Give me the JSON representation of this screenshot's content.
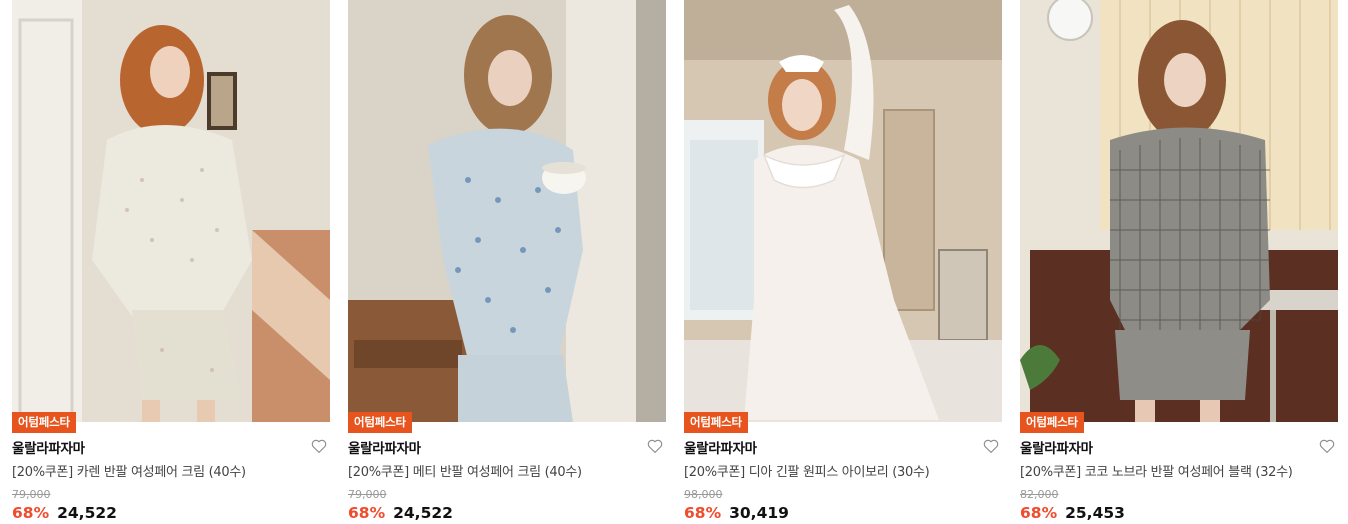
{
  "products": [
    {
      "badge": "어텀페스타",
      "brand": "울랄라파자마",
      "title": "[20%쿠폰] 카렌 반팔 여성페어 크림 (40수)",
      "original_price": "79,000",
      "discount": "68%",
      "price": "24,522",
      "heart_icon": "heart-outline-icon"
    },
    {
      "badge": "어텀페스타",
      "brand": "울랄라파자마",
      "title": "[20%쿠폰] 메티 반팔 여성페어 크림 (40수)",
      "original_price": "79,000",
      "discount": "68%",
      "price": "24,522",
      "heart_icon": "heart-outline-icon"
    },
    {
      "badge": "어텀페스타",
      "brand": "울랄라파자마",
      "title": "[20%쿠폰] 디아 긴팔 원피스 아이보리 (30수)",
      "original_price": "98,000",
      "discount": "68%",
      "price": "30,419",
      "heart_icon": "heart-outline-icon"
    },
    {
      "badge": "어텀페스타",
      "brand": "울랄라파자마",
      "title": "[20%쿠폰] 코코 노브라 반팔 여성페어 블랙 (32수)",
      "original_price": "82,000",
      "discount": "68%",
      "price": "25,453",
      "heart_icon": "heart-outline-icon"
    }
  ],
  "colors": {
    "badge_bg": "#e8541d",
    "discount": "#ef4b2c",
    "original_price": "#9a9a9a"
  }
}
